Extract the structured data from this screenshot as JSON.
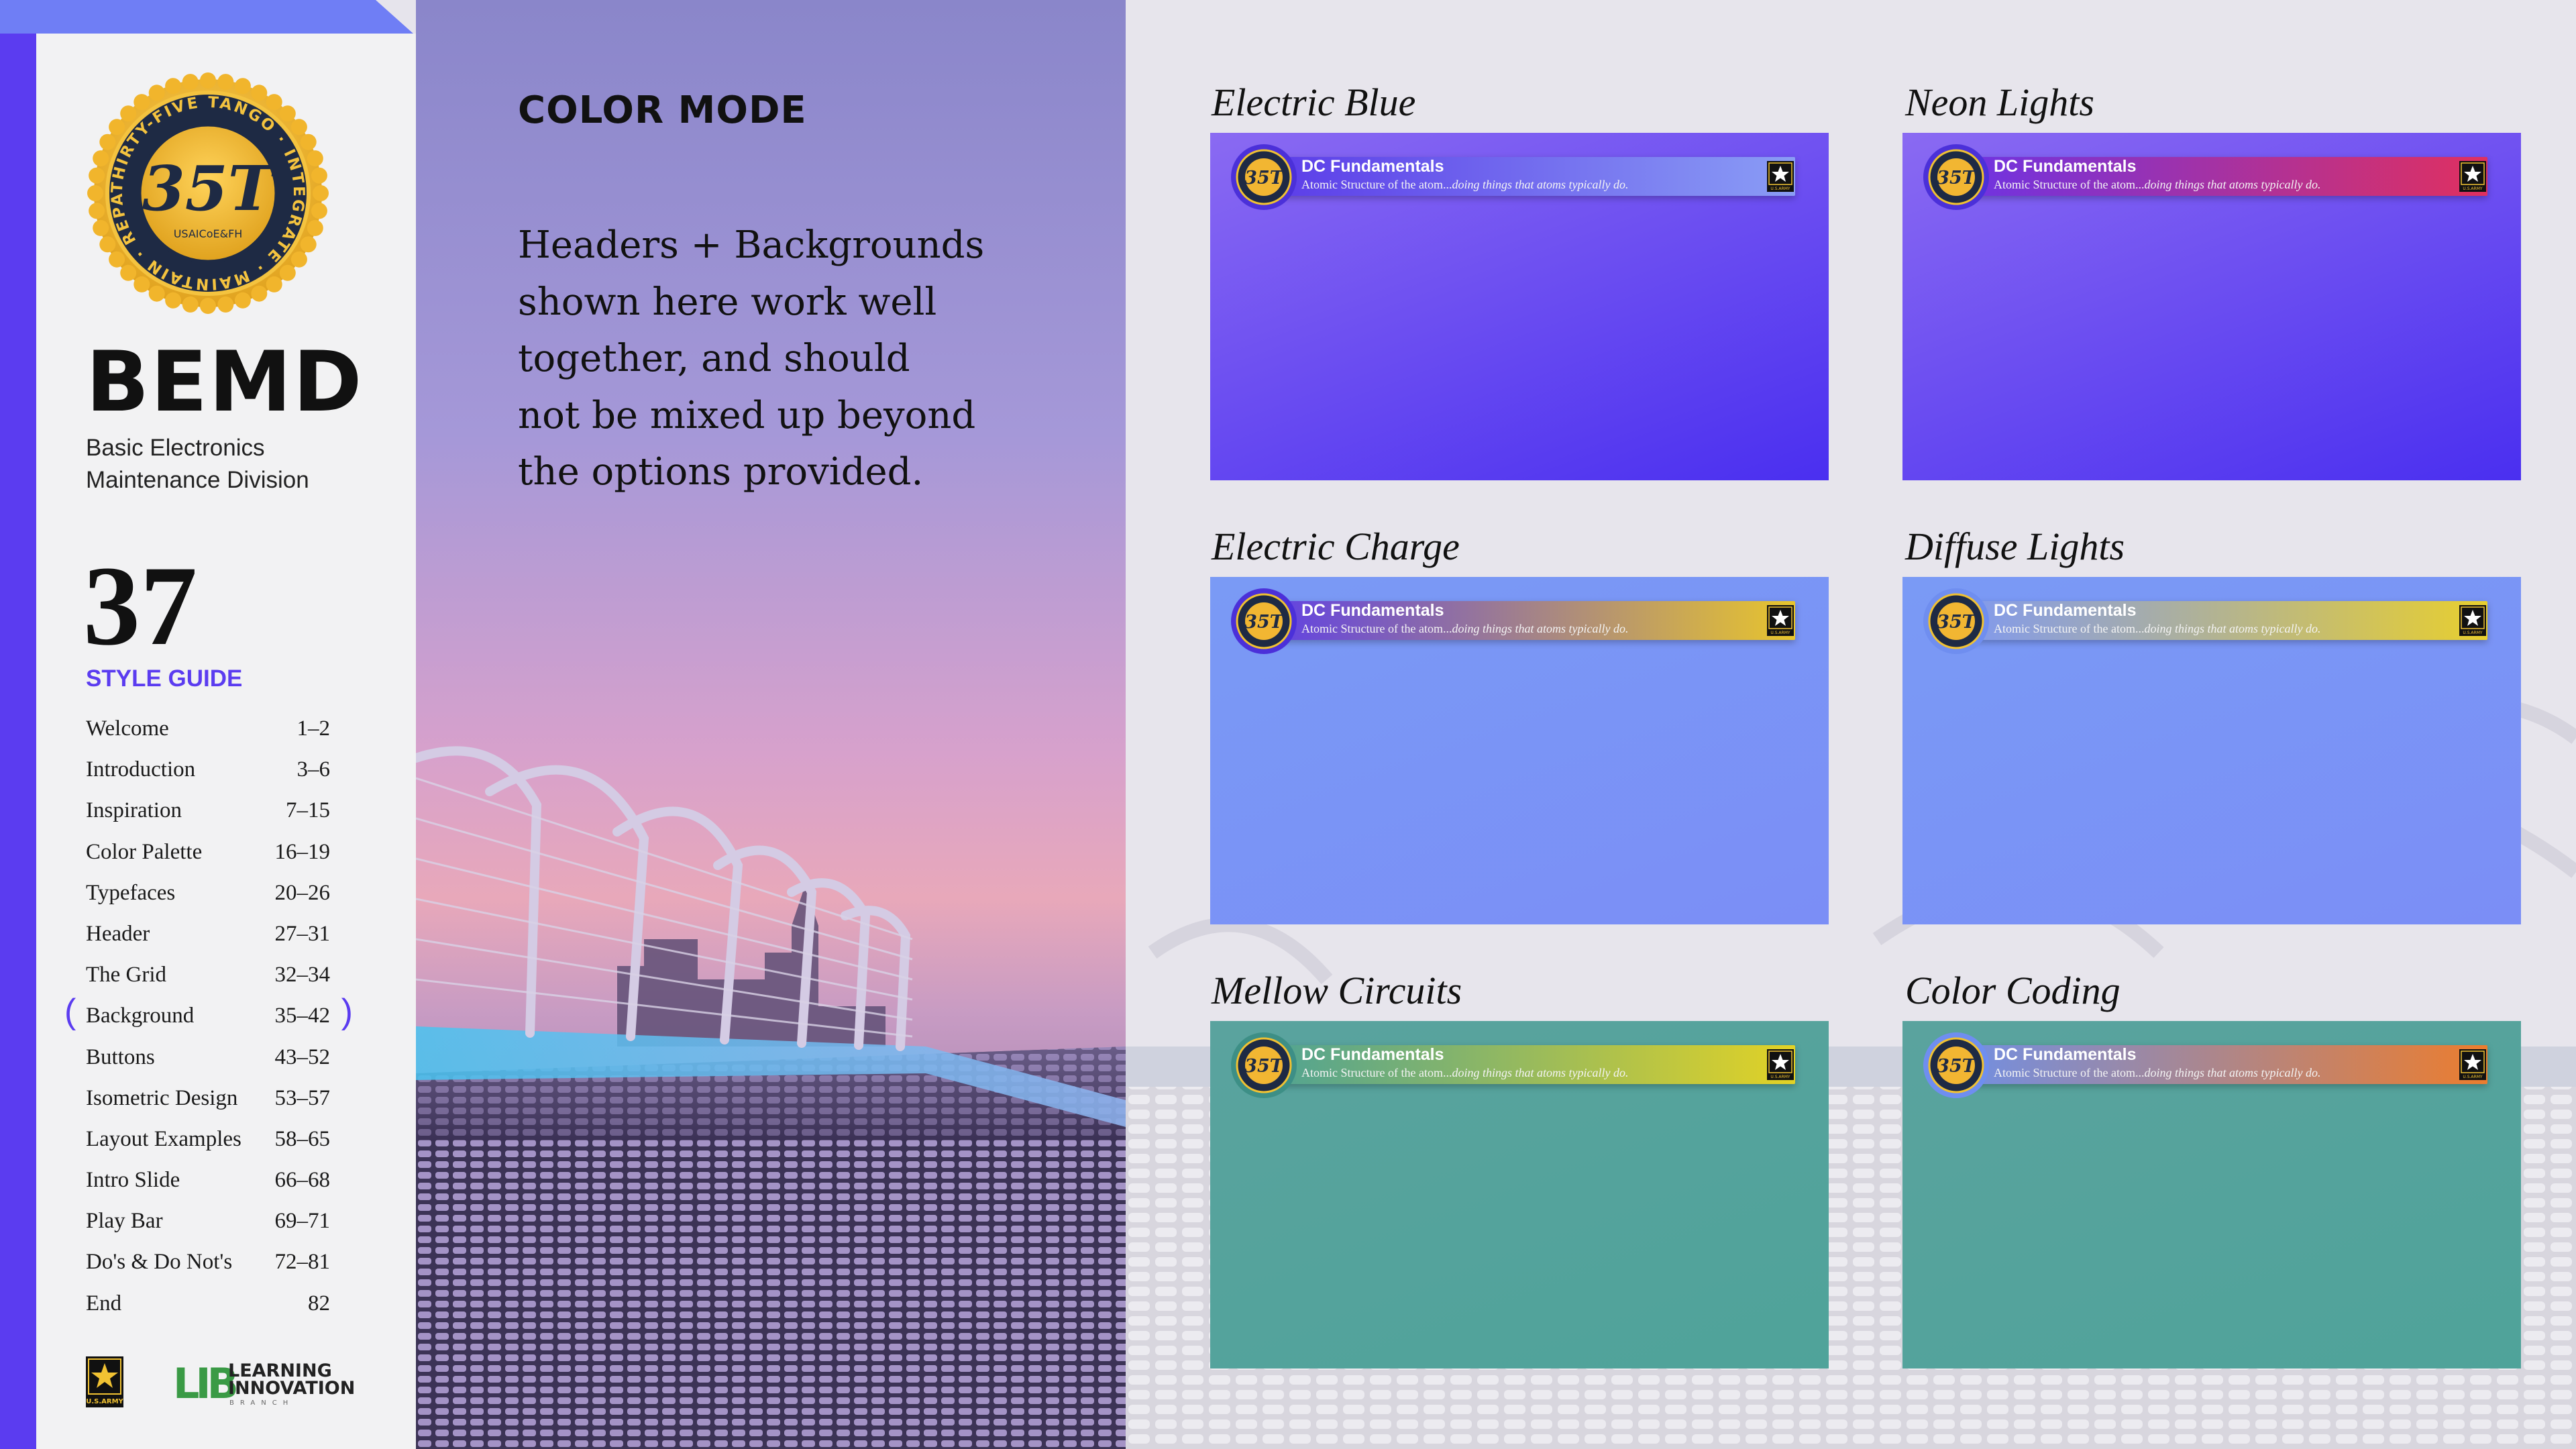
{
  "sidebar": {
    "brand": "BEMD",
    "brand_sub": "Basic Electronics Maintenance Division",
    "seal_text": "THIRTY-FIVE TANGO · INTEGRATE · MAINTAIN · REPAIR",
    "seal_center": "35T",
    "seal_small": "USAICoE&FH",
    "page_number": "37",
    "section_label": "STYLE GUIDE",
    "toc": [
      {
        "label": "Welcome",
        "pages": "1–2"
      },
      {
        "label": "Introduction",
        "pages": "3–6"
      },
      {
        "label": "Inspiration",
        "pages": "7–15"
      },
      {
        "label": "Color Palette",
        "pages": "16–19"
      },
      {
        "label": "Typefaces",
        "pages": "20–26"
      },
      {
        "label": "Header",
        "pages": "27–31"
      },
      {
        "label": "The Grid",
        "pages": "32–34"
      },
      {
        "label": "Background",
        "pages": "35–42",
        "active": true
      },
      {
        "label": "Buttons",
        "pages": "43–52"
      },
      {
        "label": "Isometric Design",
        "pages": "53–57"
      },
      {
        "label": "Layout Examples",
        "pages": "58–65"
      },
      {
        "label": "Intro Slide",
        "pages": "66–68"
      },
      {
        "label": "Play Bar",
        "pages": "69–71"
      },
      {
        "label": "Do's & Do Not's",
        "pages": "72–81"
      },
      {
        "label": "End",
        "pages": "82"
      }
    ],
    "footer_logo_army": "U.S.ARMY",
    "footer_logo_lib_mark": "LIB",
    "footer_logo_lib_line1": "LEARNING",
    "footer_logo_lib_line2": "INNOVATION",
    "footer_logo_lib_line3": "BRANCH"
  },
  "main": {
    "title": "COLOR MODE",
    "body_lines": [
      "Headers + Backgrounds",
      "shown here work well",
      "together, and should",
      "not be mixed up beyond",
      "the options provided."
    ]
  },
  "cards": [
    {
      "name": "Electric Blue",
      "bg": [
        "#8a6af2",
        "#4a2ff0"
      ],
      "bar": [
        "#5a3ae8",
        "#8a9df5"
      ],
      "ring": "#4b30d9"
    },
    {
      "name": "Neon Lights",
      "bg": [
        "#8a6af2",
        "#4a2ff0"
      ],
      "bar": [
        "#6b33e6",
        "#e0305f"
      ],
      "ring": "#4b30d9"
    },
    {
      "name": "Electric Charge",
      "bg": [
        "#7a9af5",
        "#7b8ef6"
      ],
      "bar": [
        "#5d3ee8",
        "#e8c52c"
      ],
      "ring": "#4b30d9"
    },
    {
      "name": "Diffuse Lights",
      "bg": [
        "#7a9af5",
        "#7b8ef6"
      ],
      "bar": [
        "#7e98f4",
        "#e8cf2e"
      ],
      "ring": "#6f8ef0"
    },
    {
      "name": "Mellow Circuits",
      "bg": [
        "#5aa39e",
        "#4fa39a"
      ],
      "bar": [
        "#4da295",
        "#e2d225"
      ],
      "ring": "#3d8f86"
    },
    {
      "name": "Color Coding",
      "bg": [
        "#5aa39e",
        "#4fa39a"
      ],
      "bar": [
        "#6f8fe6",
        "#ec7d2e"
      ],
      "ring": "#6f8ef0"
    }
  ],
  "card_header": {
    "title": "DC Fundamentals",
    "subtitle_plain": "Atomic Structure of the atom...",
    "subtitle_italic": "doing things that atoms typically do.",
    "medal_text": "35T",
    "star_caption": "U.S.ARMY"
  }
}
